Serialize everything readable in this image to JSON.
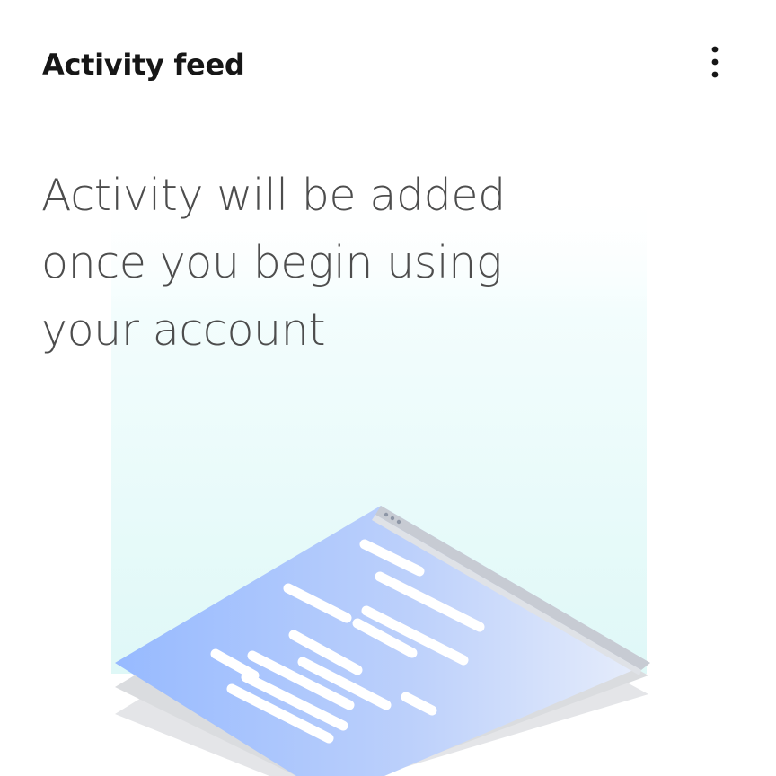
{
  "card": {
    "title": "Activity feed",
    "menu_icon": "overflow-menu-vertical-icon",
    "empty_state": {
      "message": "Activity will be added once you begin using your account",
      "illustration": "isometric-document-stack"
    }
  },
  "colors": {
    "title": "#161616",
    "message": "#4d4d4d",
    "glow": "#dff8f7",
    "doc_light": "#e6ecfb",
    "doc_blue": "#97baff",
    "sheet_shadow": "#dcdcdc"
  }
}
